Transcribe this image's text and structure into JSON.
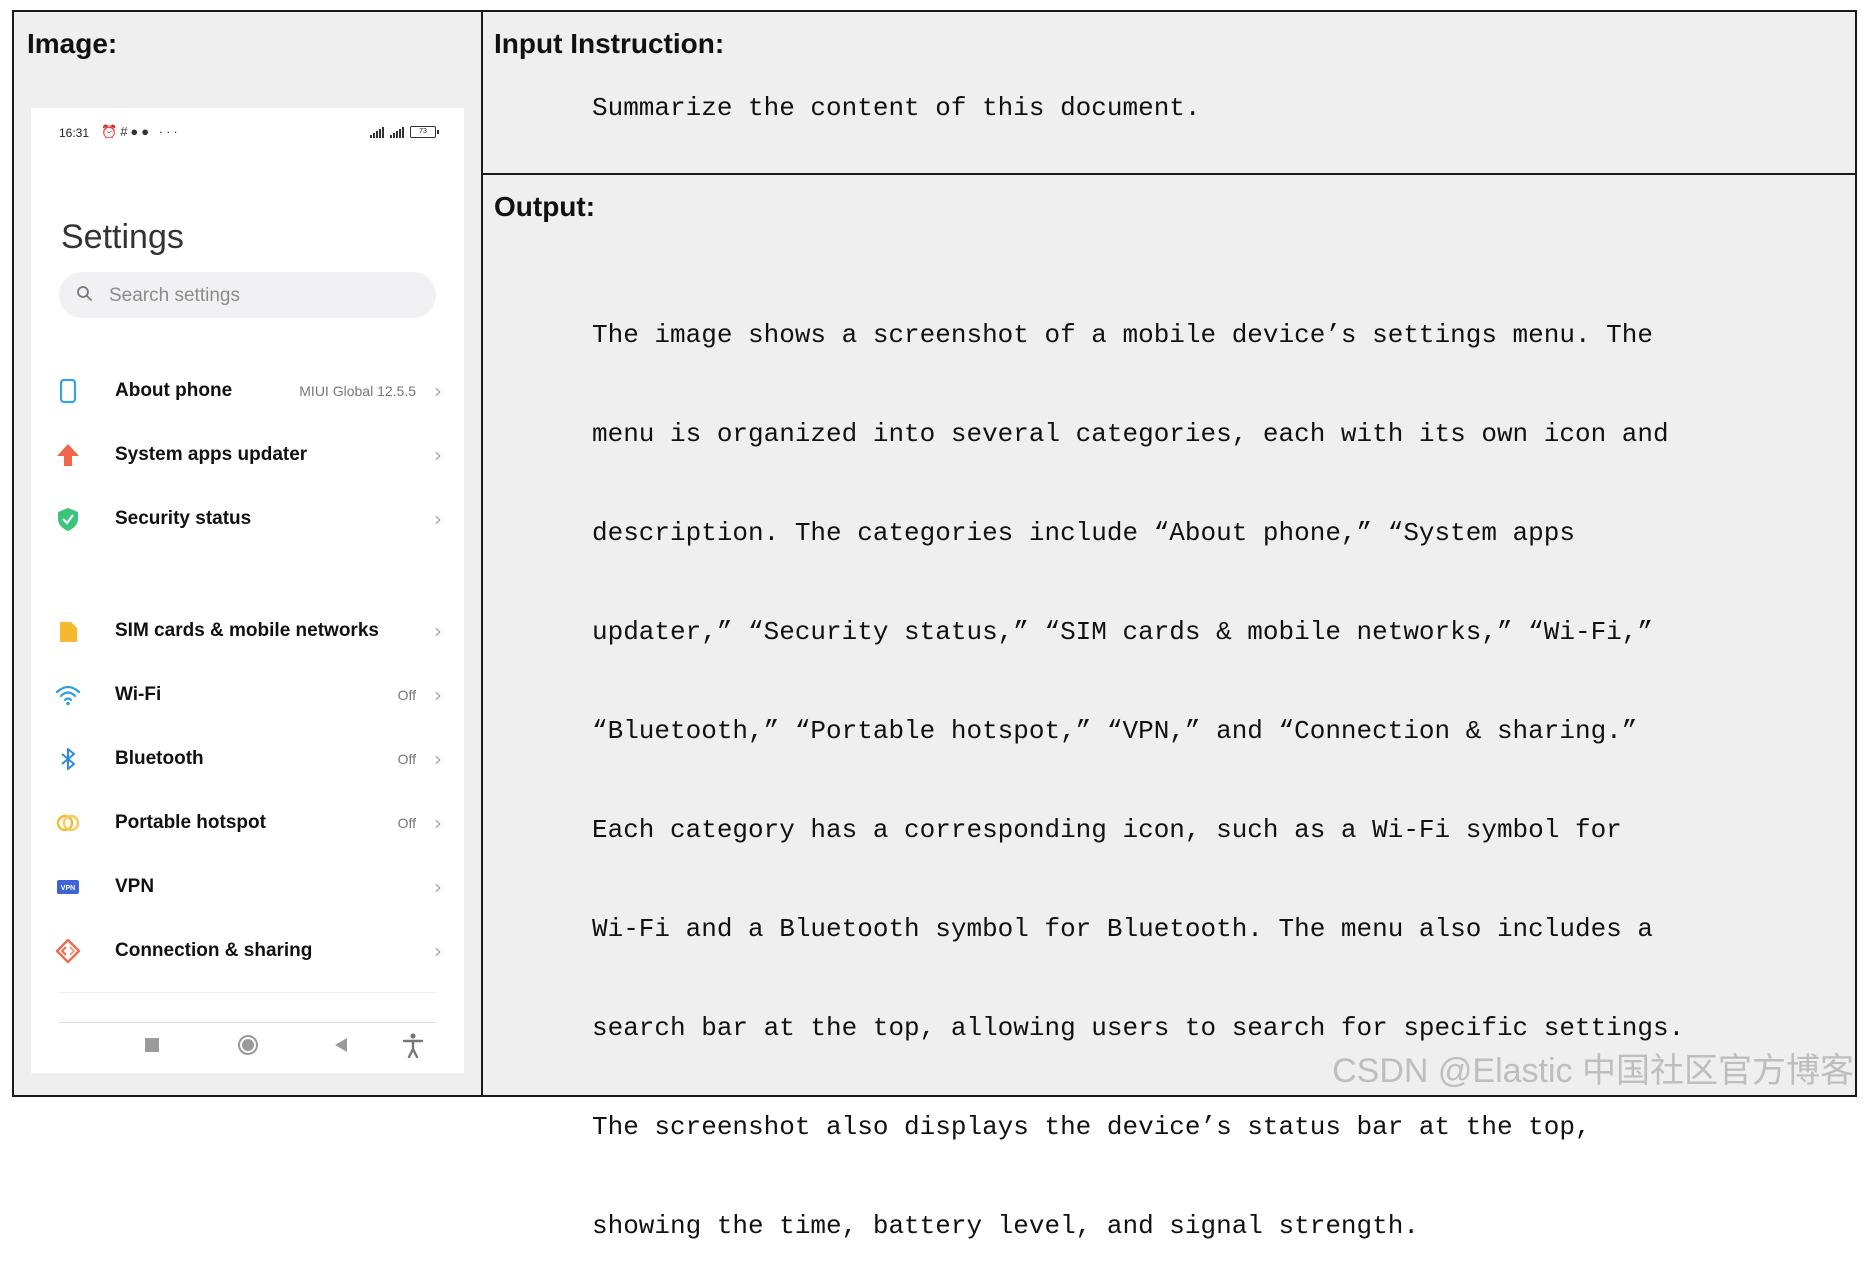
{
  "panels": {
    "image_heading": "Image:",
    "instruction_heading": "Input Instruction:",
    "output_heading": "Output:"
  },
  "instruction": "Summarize the content of this document.",
  "output_lines": [
    "The image shows a screenshot of a mobile device’s settings menu. The",
    "menu is organized into several categories, each with its own icon and",
    "description. The categories include “About phone,” “System apps",
    "updater,” “Security status,” “SIM cards & mobile networks,” “Wi-Fi,”",
    "“Bluetooth,” “Portable hotspot,” “VPN,” and “Connection & sharing.”",
    "Each category has a corresponding icon, such as a Wi-Fi symbol for",
    "Wi-Fi and a Bluetooth symbol for Bluetooth. The menu also includes a",
    "search bar at the top, allowing users to search for specific settings.",
    "The screenshot also displays the device’s status bar at the top,",
    "showing the time, battery level, and signal strength."
  ],
  "phone": {
    "status": {
      "time": "16:31",
      "battery": "73",
      "more": "···"
    },
    "title": "Settings",
    "search_placeholder": "Search settings",
    "items": [
      {
        "label": "About phone",
        "value": "MIUI Global 12.5.5",
        "icon": "phone-icon",
        "color": "#3aa0e8"
      },
      {
        "label": "System apps updater",
        "value": "",
        "icon": "arrow-up-icon",
        "color": "#f2664a"
      },
      {
        "label": "Security status",
        "value": "",
        "icon": "shield-icon",
        "color": "#3cc47c"
      },
      {
        "label": "SIM cards & mobile networks",
        "value": "",
        "icon": "sim-icon",
        "color": "#f5b82e"
      },
      {
        "label": "Wi-Fi",
        "value": "Off",
        "icon": "wifi-icon",
        "color": "#2d9fe0"
      },
      {
        "label": "Bluetooth",
        "value": "Off",
        "icon": "bluetooth-icon",
        "color": "#2d8ae0"
      },
      {
        "label": "Portable hotspot",
        "value": "Off",
        "icon": "hotspot-icon",
        "color": "#f5b82e"
      },
      {
        "label": "VPN",
        "value": "",
        "icon": "vpn-icon",
        "color": "#3d63d6"
      },
      {
        "label": "Connection & sharing",
        "value": "",
        "icon": "connection-icon",
        "color": "#ef6d4f"
      }
    ]
  },
  "watermark": "CSDN @Elastic 中国社区官方博客"
}
